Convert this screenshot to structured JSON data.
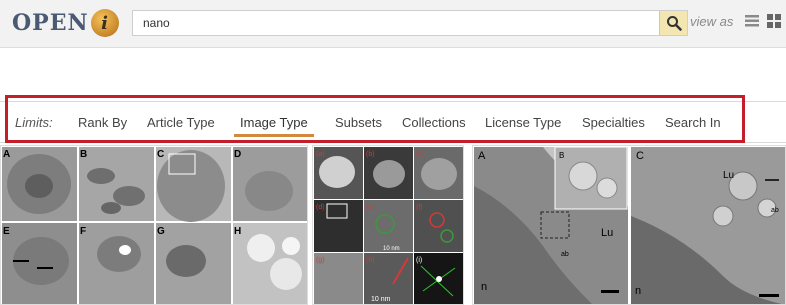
{
  "header": {
    "logo_text": "OPEN",
    "logo_i": "i",
    "search": {
      "value": "nano",
      "button_icon": "search-icon"
    },
    "view_as_label": "view as",
    "view_icons": [
      "list-view-icon",
      "grid-view-icon"
    ]
  },
  "limits": {
    "label": "Limits:",
    "items": [
      "Rank By",
      "Article Type",
      "Image Type",
      "Subsets",
      "Collections",
      "License Type",
      "Specialties",
      "Search In"
    ],
    "active_index": 2,
    "accent_color": "#d18a3c",
    "highlight_color": "#c41e2a"
  },
  "thumbnails": {
    "t1": {
      "labels": [
        "A",
        "B",
        "C",
        "D",
        "E",
        "F",
        "G",
        "H"
      ]
    },
    "t2": {
      "labels": [
        "(a)",
        "(b)",
        "(c)",
        "(d)",
        "(e)",
        "(f)",
        "(g)",
        "(h)",
        "(i)"
      ],
      "scale_labels": [
        "10 nm",
        "10 nm"
      ]
    },
    "t3": {
      "labels": [
        "A",
        "B",
        "C",
        "Lu",
        "Lu",
        "n",
        "n",
        "ab",
        "ab"
      ]
    }
  }
}
